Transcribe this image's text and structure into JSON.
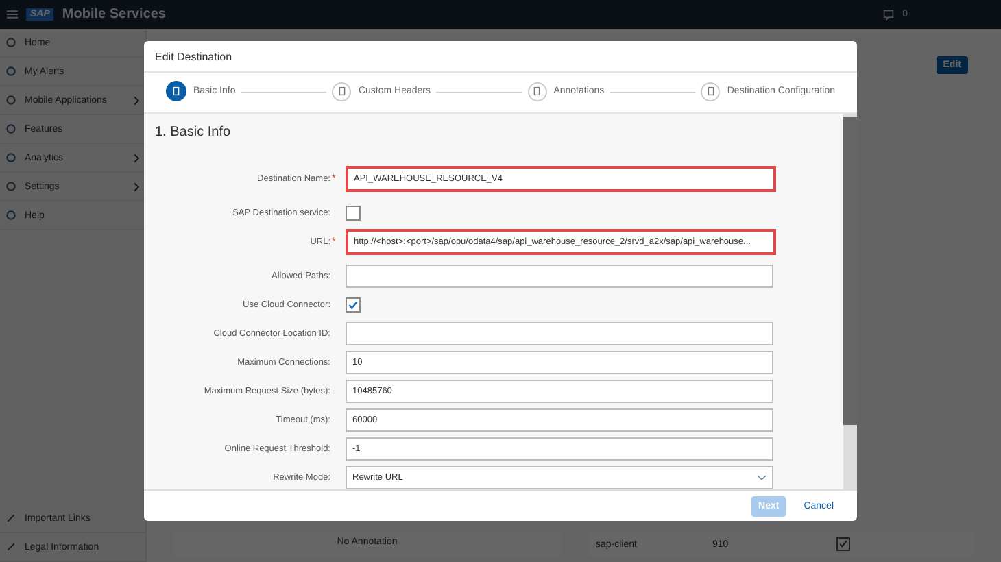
{
  "header": {
    "logo": "SAP",
    "title": "Mobile Services",
    "notifications": "0"
  },
  "sidebar": {
    "items": [
      {
        "label": "Home",
        "has_submenu": false
      },
      {
        "label": "My Alerts",
        "has_submenu": false
      },
      {
        "label": "Mobile Applications",
        "has_submenu": true
      },
      {
        "label": "Features",
        "has_submenu": false
      },
      {
        "label": "Analytics",
        "has_submenu": true
      },
      {
        "label": "Settings",
        "has_submenu": true
      },
      {
        "label": "Help",
        "has_submenu": false
      }
    ],
    "footer_items": [
      {
        "label": "Important Links"
      },
      {
        "label": "Legal Information"
      }
    ]
  },
  "page": {
    "edit_button": "Edit",
    "annotations_table": {
      "empty_text": "No Annotation"
    },
    "headers_table": {
      "rows": [
        {
          "name": "sap-client",
          "value": "910",
          "override_client": true
        }
      ]
    }
  },
  "dialog": {
    "title": "Edit Destination",
    "steps": [
      {
        "label": "Basic Info",
        "selected": true
      },
      {
        "label": "Custom Headers",
        "selected": false
      },
      {
        "label": "Annotations",
        "selected": false
      },
      {
        "label": "Destination Configuration",
        "selected": false
      }
    ],
    "section_title": "1. Basic Info",
    "fields": [
      {
        "kind": "text",
        "label": "Destination Name:",
        "required_mark": "*",
        "highlighted": true,
        "value": "API_WAREHOUSE_RESOURCE_V4"
      },
      {
        "kind": "checkbox",
        "label": "SAP Destination service:",
        "checked": false
      },
      {
        "kind": "text",
        "label": "URL:",
        "required_mark": "*",
        "highlighted": true,
        "value": "http://<host>:<port>/sap/opu/odata4/sap/api_warehouse_resource_2/srvd_a2x/sap/api_warehouse..."
      },
      {
        "kind": "text",
        "label": "Allowed Paths:",
        "highlighted": false
      },
      {
        "kind": "checkbox",
        "label": "Use Cloud Connector:",
        "checked": true
      },
      {
        "kind": "text",
        "label": "Cloud Connector Location ID:",
        "highlighted": false
      },
      {
        "kind": "text",
        "label": "Maximum Connections:",
        "highlighted": false,
        "value": "10"
      },
      {
        "kind": "text",
        "label": "Maximum Request Size (bytes):",
        "highlighted": false,
        "value": "10485760"
      },
      {
        "kind": "text",
        "label": "Timeout (ms):",
        "highlighted": false,
        "value": "60000"
      },
      {
        "kind": "text",
        "label": "Online Request Threshold:",
        "highlighted": false,
        "value": "-1"
      },
      {
        "kind": "select",
        "label": "Rewrite Mode:",
        "highlighted": false,
        "value": "Rewrite URL"
      }
    ],
    "buttons": [
      {
        "label": "Next",
        "kind": "primary",
        "disabled": true
      },
      {
        "label": "Cancel",
        "kind": "secondary",
        "disabled": false
      }
    ]
  }
}
